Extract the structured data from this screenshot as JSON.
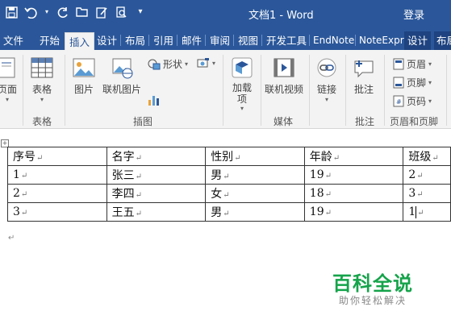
{
  "titlebar": {
    "doc_title": "文档1 - Word",
    "login": "登录"
  },
  "tabs": [
    "文件",
    "开始",
    "插入",
    "设计",
    "布局",
    "引用",
    "邮件",
    "审阅",
    "视图",
    "开发工具",
    "EndNote",
    "NoteExpre",
    "设计",
    "布局"
  ],
  "active_tab": "插入",
  "ribbon": {
    "page_label": "页面",
    "table_label": "表格",
    "picture_label": "图片",
    "online_picture_label": "联机图片",
    "shapes_label": "形状",
    "addin_label": "加载项",
    "online_video_label": "联机视频",
    "link_label": "链接",
    "comment_label": "批注",
    "header_label": "页眉",
    "footer_label": "页脚",
    "page_number_label": "页码",
    "groups": {
      "table": "表格",
      "illustrations": "插图",
      "media": "媒体",
      "comments": "批注",
      "header_footer": "页眉和页脚"
    }
  },
  "table": {
    "rows": [
      [
        "序号",
        "名字",
        "性别",
        "年龄",
        "班级"
      ],
      [
        "1",
        "张三",
        "男",
        "19",
        "2"
      ],
      [
        "2",
        "李四",
        "女",
        "18",
        "3"
      ],
      [
        "3",
        "王五",
        "男",
        "19",
        "1"
      ]
    ]
  },
  "watermark": {
    "title": "百科全说",
    "subtitle": "助你轻松解决"
  },
  "colors": {
    "accent": "#2b579a",
    "ribbon_bg": "#f3f3f3",
    "watermark_green": "#15a34a"
  }
}
